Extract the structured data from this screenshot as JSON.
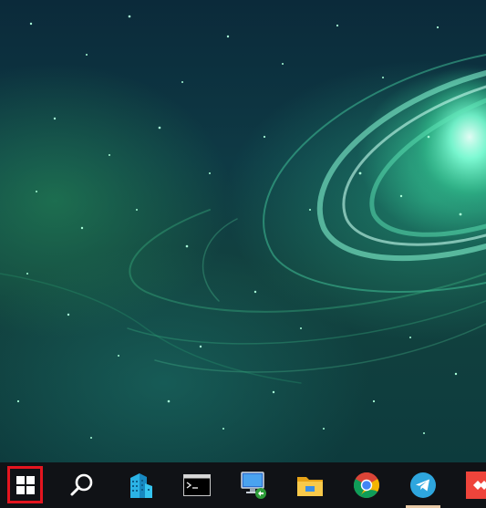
{
  "desktop": {
    "wallpaper": "green-nebula-galaxy",
    "colors": {
      "base": "#0e3a45",
      "glow": "#7effd6",
      "accent": "#3fbf8a"
    }
  },
  "taskbar": {
    "background": "#101216",
    "items": [
      {
        "id": "start",
        "icon": "windows-logo-icon",
        "highlighted": true,
        "highlight_color": "#e4151f"
      },
      {
        "id": "search",
        "icon": "search-icon"
      },
      {
        "id": "app-buildings",
        "icon": "buildings-app-icon"
      },
      {
        "id": "terminal",
        "icon": "terminal-icon"
      },
      {
        "id": "remote-desktop",
        "icon": "remote-desktop-icon"
      },
      {
        "id": "file-explorer",
        "icon": "folder-icon"
      },
      {
        "id": "chrome",
        "icon": "chrome-icon"
      },
      {
        "id": "telegram",
        "icon": "telegram-icon",
        "running": true
      },
      {
        "id": "anydesk",
        "icon": "anydesk-icon"
      }
    ]
  }
}
